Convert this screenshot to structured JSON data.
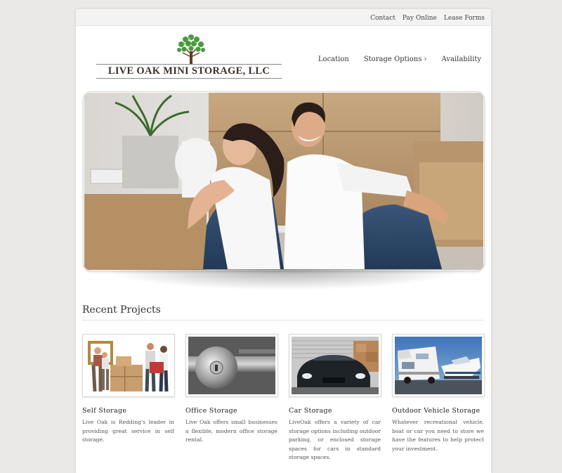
{
  "top_links": [
    "Contact",
    "Pay Online",
    "Lease Forms"
  ],
  "logo": {
    "text": "LIVE OAK MINI STORAGE, LLC"
  },
  "nav": {
    "location": "Location",
    "storage_options": "Storage Options",
    "storage_arrow": "›",
    "availability": "Availability"
  },
  "section": {
    "title": "Recent Projects"
  },
  "cards": [
    {
      "title": "Self Storage",
      "text": "Live Oak is Redding's leader in providing great service in self storage."
    },
    {
      "title": "Office Storage",
      "text": "Live Oak offers small businesses a flexible, modern office storage rental."
    },
    {
      "title": "Car Storage",
      "text": "LiveOak offers a variety of car storage options including outdoor parking, or enclosed storage spaces for cars in standard storage spaces."
    },
    {
      "title": "Outdoor Vehicle Storage",
      "text": "Whatever recreational vehicle, boat or car you need to store we have the features to help protect your investment."
    }
  ],
  "colors": {
    "background": "#ebe9e8",
    "topbar": "#f3f3f3",
    "text": "#333333",
    "tree_green": "#4a9a3c",
    "trunk": "#6b3b22"
  }
}
